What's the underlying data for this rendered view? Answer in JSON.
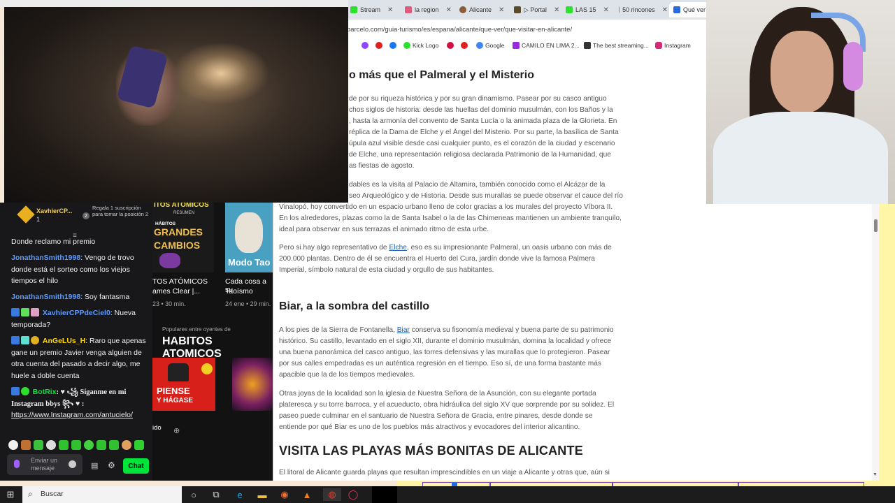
{
  "browser": {
    "tabs": [
      {
        "label": "",
        "icon": "globe-icon"
      },
      {
        "label": "Stream",
        "icon": "kick-icon"
      },
      {
        "label": "la region",
        "icon": "shield-icon"
      },
      {
        "label": "Alicante",
        "icon": "avatar-icon"
      },
      {
        "label": "▷ Portal",
        "icon": "play-icon"
      },
      {
        "label": "LAS 15",
        "icon": "kick-icon"
      },
      {
        "label": "50 rincones",
        "icon": "circle-icon"
      },
      {
        "label": "Qué ver",
        "icon": "doc-icon"
      }
    ],
    "url": "barcelo.com/guia-turismo/es/espana/alicante/que-ver/que-visitar-en-alicante/",
    "bookmarks": [
      "Kick Logo",
      "Google",
      "CAMILO EN LIMA 2...",
      "The best streaming...",
      "Instagram"
    ]
  },
  "article": {
    "h_misterio": "o más que el Palmeral y el Misterio",
    "p1": [
      "de por su riqueza histórica y por su gran dinamismo. Pasear por su casco antiguo",
      "chos siglos de historia: desde las huellas del dominio musulmán, con los Baños y la",
      ", hasta la armonía del convento de Santa Lucía o la animada plaza de la Glorieta. En",
      "réplica de la Dama de Elche y el Ángel del Misterio. Por su parte, la basílica de Santa",
      "úpula azul visible desde casi cualquier punto, es el corazón de la ciudad y escenario",
      "de Elche, una representación religiosa declarada Patrimonio de la Humanidad, que",
      "as fiestas de agosto."
    ],
    "p2": [
      "dables es la visita al Palacio de Altamira, también conocido como el Alcázar de la",
      "seo Arqueológico y de Historia. Desde sus murallas se puede observar el cauce del río",
      "Vinalopó, hoy convertido en un espacio urbano lleno de color gracias a los murales del proyecto Víbora II.",
      "En los alrededores, plazas como la de Santa Isabel o la de las Chimeneas mantienen un ambiente tranquilo,",
      "ideal para observar en sus terrazas el animado ritmo de esta urbe."
    ],
    "p3_before": "Pero si hay algo representativo de ",
    "p3_link": "Elche",
    "p3_after": ", eso es su impresionante Palmeral, un oasis urbano con más de",
    "p3_rest": [
      "200.000 plantas. Dentro de él se encuentra el Huerto del Cura, jardín donde vive la famosa Palmera",
      "Imperial, símbolo natural de esta ciudad y orgullo de sus habitantes."
    ],
    "h_biar": "Biar, a la sombra del castillo",
    "p4_before": "A los pies de la Sierra de Fontanella, ",
    "p4_link": "Biar",
    "p4_after": " conserva su fisonomía medieval y buena parte de su patrimonio",
    "p4_rest": [
      "histórico. Su castillo, levantado en el siglo XII, durante el dominio musulmán, domina la localidad y ofrece",
      "una buena panorámica del casco antiguo, las torres defensivas y las murallas que lo protegieron. Pasear",
      "por sus calles empedradas es un auténtica regresión en el tiempo. Eso sí, de una forma bastante más",
      "apacible que la de los tiempos medievales."
    ],
    "p5": [
      "Otras joyas de la localidad son la iglesia de Nuestra Señora de la Asunción, con su elegante portada",
      "plateresca y su torre barroca, y el acueducto, obra hidráulica del siglo XV que sorprende por su solidez. El",
      "paseo puede culminar en el santuario de Nuestra Señora de Gracia, entre pinares, desde donde se",
      "entiende por qué Biar es uno de los pueblos más atractivos y evocadores del interior alicantino."
    ],
    "h_playas": "VISITA LAS PLAYAS MÁS BONITAS DE ALICANTE",
    "p6": "El litoral de Alicante guarda playas que resultan imprescindibles en un viaje a Alicante y otras que, aún si"
  },
  "spotify": {
    "card1_title": "TOS ATÓMICOS",
    "card1_sub": "ames Clear |...",
    "card1_meta": "23 • 30 min.",
    "card1_art_top": "ITOS ATÓMICOS",
    "card1_art_mid": "HÁBITOS",
    "card1_art_big1": "GRANDES",
    "card1_art_big2": "CAMBIOS",
    "card1_art_resumen": "RESUMEN",
    "card2_title": "Cada cosa a su",
    "card2_sub": "Taoísmo",
    "card2_meta": "24 ene • 29 min.",
    "card2_art": "Modo Tao",
    "popular_label": "Populares entre oyentes de",
    "popular_title": "HABITOS ATOMICOS",
    "tile_text1": "PIENSE",
    "tile_text2": "Y HÁGASE",
    "bottom_label": "ido"
  },
  "chat": {
    "top_user": "XavhierCP...",
    "top_count": "1",
    "gift_text": "Regala 1 suscripción para tomar la posición 2",
    "gift_num": "2",
    "messages": [
      {
        "user": "",
        "text": "Donde reclamo mi premio",
        "color": "#efeff1"
      },
      {
        "user": "JonathanSmith1998",
        "text": ": Vengo de trovo donde está el sorteo como los viejos tiempos el hilo",
        "color": "#5c9aff"
      },
      {
        "user": "JonathanSmith1998",
        "text": ": Soy fantasma",
        "color": "#5c9aff"
      },
      {
        "user": "XavhierCPPdeCiel0",
        "text": ": Nueva temporada?",
        "color": "#5c9aff"
      },
      {
        "user": "AnGeLUs_H",
        "text": ": Raro que apenas gane un premio Javier venga alguien de otra cuenta del pasado a decir algo, me huele a doble cuenta",
        "color": "#ffd700"
      },
      {
        "user": "BotRix",
        "text": ": ♥ ꧁ Síganme en mi Instagram bbys ꧂ ♥ :",
        "color": "#00e43a"
      }
    ],
    "link": "https://www.Instagram.com/antucielo/",
    "input_placeholder": "Enviar un mensaje",
    "chat_button": "Chat"
  },
  "taskbar": {
    "search_placeholder": "Buscar"
  }
}
